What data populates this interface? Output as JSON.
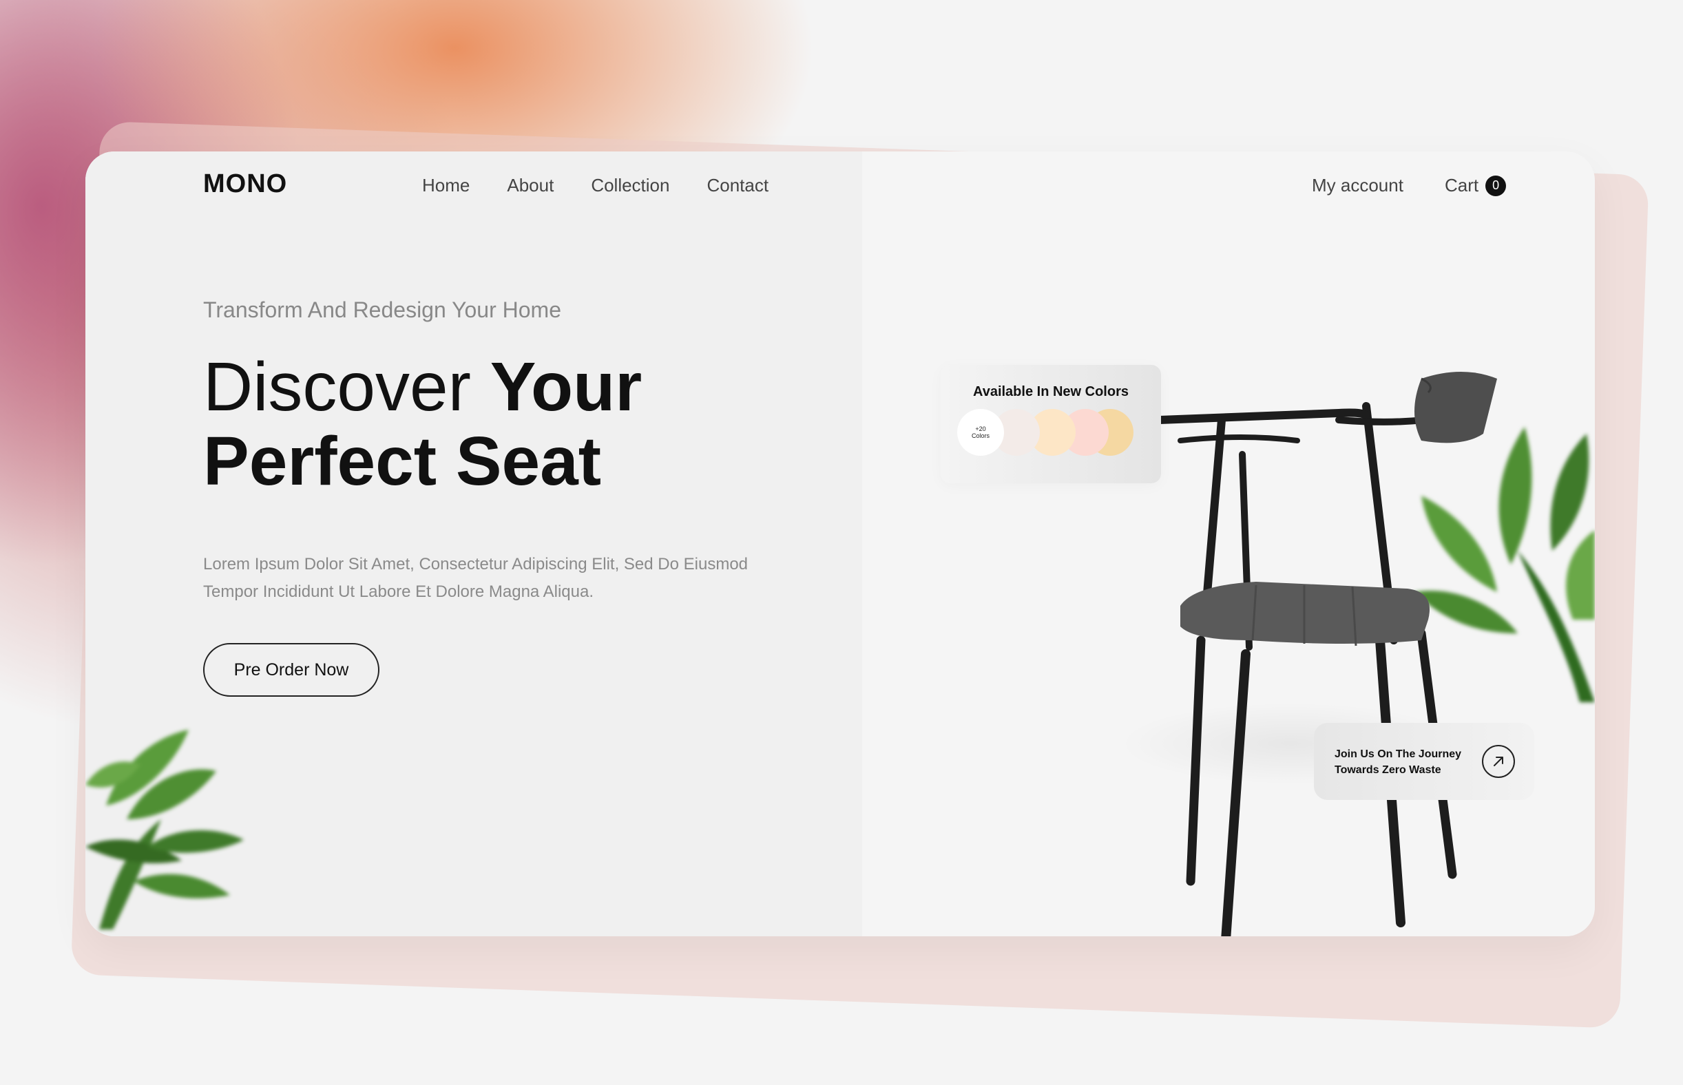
{
  "header": {
    "logo": "MONO",
    "nav": [
      "Home",
      "About",
      "Collection",
      "Contact"
    ],
    "account": "My account",
    "cart_label": "Cart",
    "cart_count": "0"
  },
  "hero": {
    "subtitle": "Transform And Redesign Your Home",
    "headline_thin": "Discover ",
    "headline_bold_1": "Your",
    "headline_bold_2": "Perfect Seat",
    "description_line1": "Lorem Ipsum Dolor Sit Amet, Consectetur Adipiscing Elit, Sed Do Eiusmod",
    "description_line2": "Tempor Incididunt Ut Labore Et Dolore Magna Aliqua.",
    "cta_label": "Pre Order Now"
  },
  "colors_card": {
    "title": "Available In New Colors",
    "more_line1": "+20",
    "more_line2": "Colors",
    "swatches": [
      "#f3ebe8",
      "#fde6c6",
      "#fcd9d2",
      "#f5d8a2"
    ]
  },
  "journey_card": {
    "line1": "Join Us On The Journey",
    "line2": "Towards Zero Waste",
    "icon": "arrow-up-right-icon"
  },
  "colors": {
    "accent": "#111111",
    "background": "#f4f4f4"
  }
}
